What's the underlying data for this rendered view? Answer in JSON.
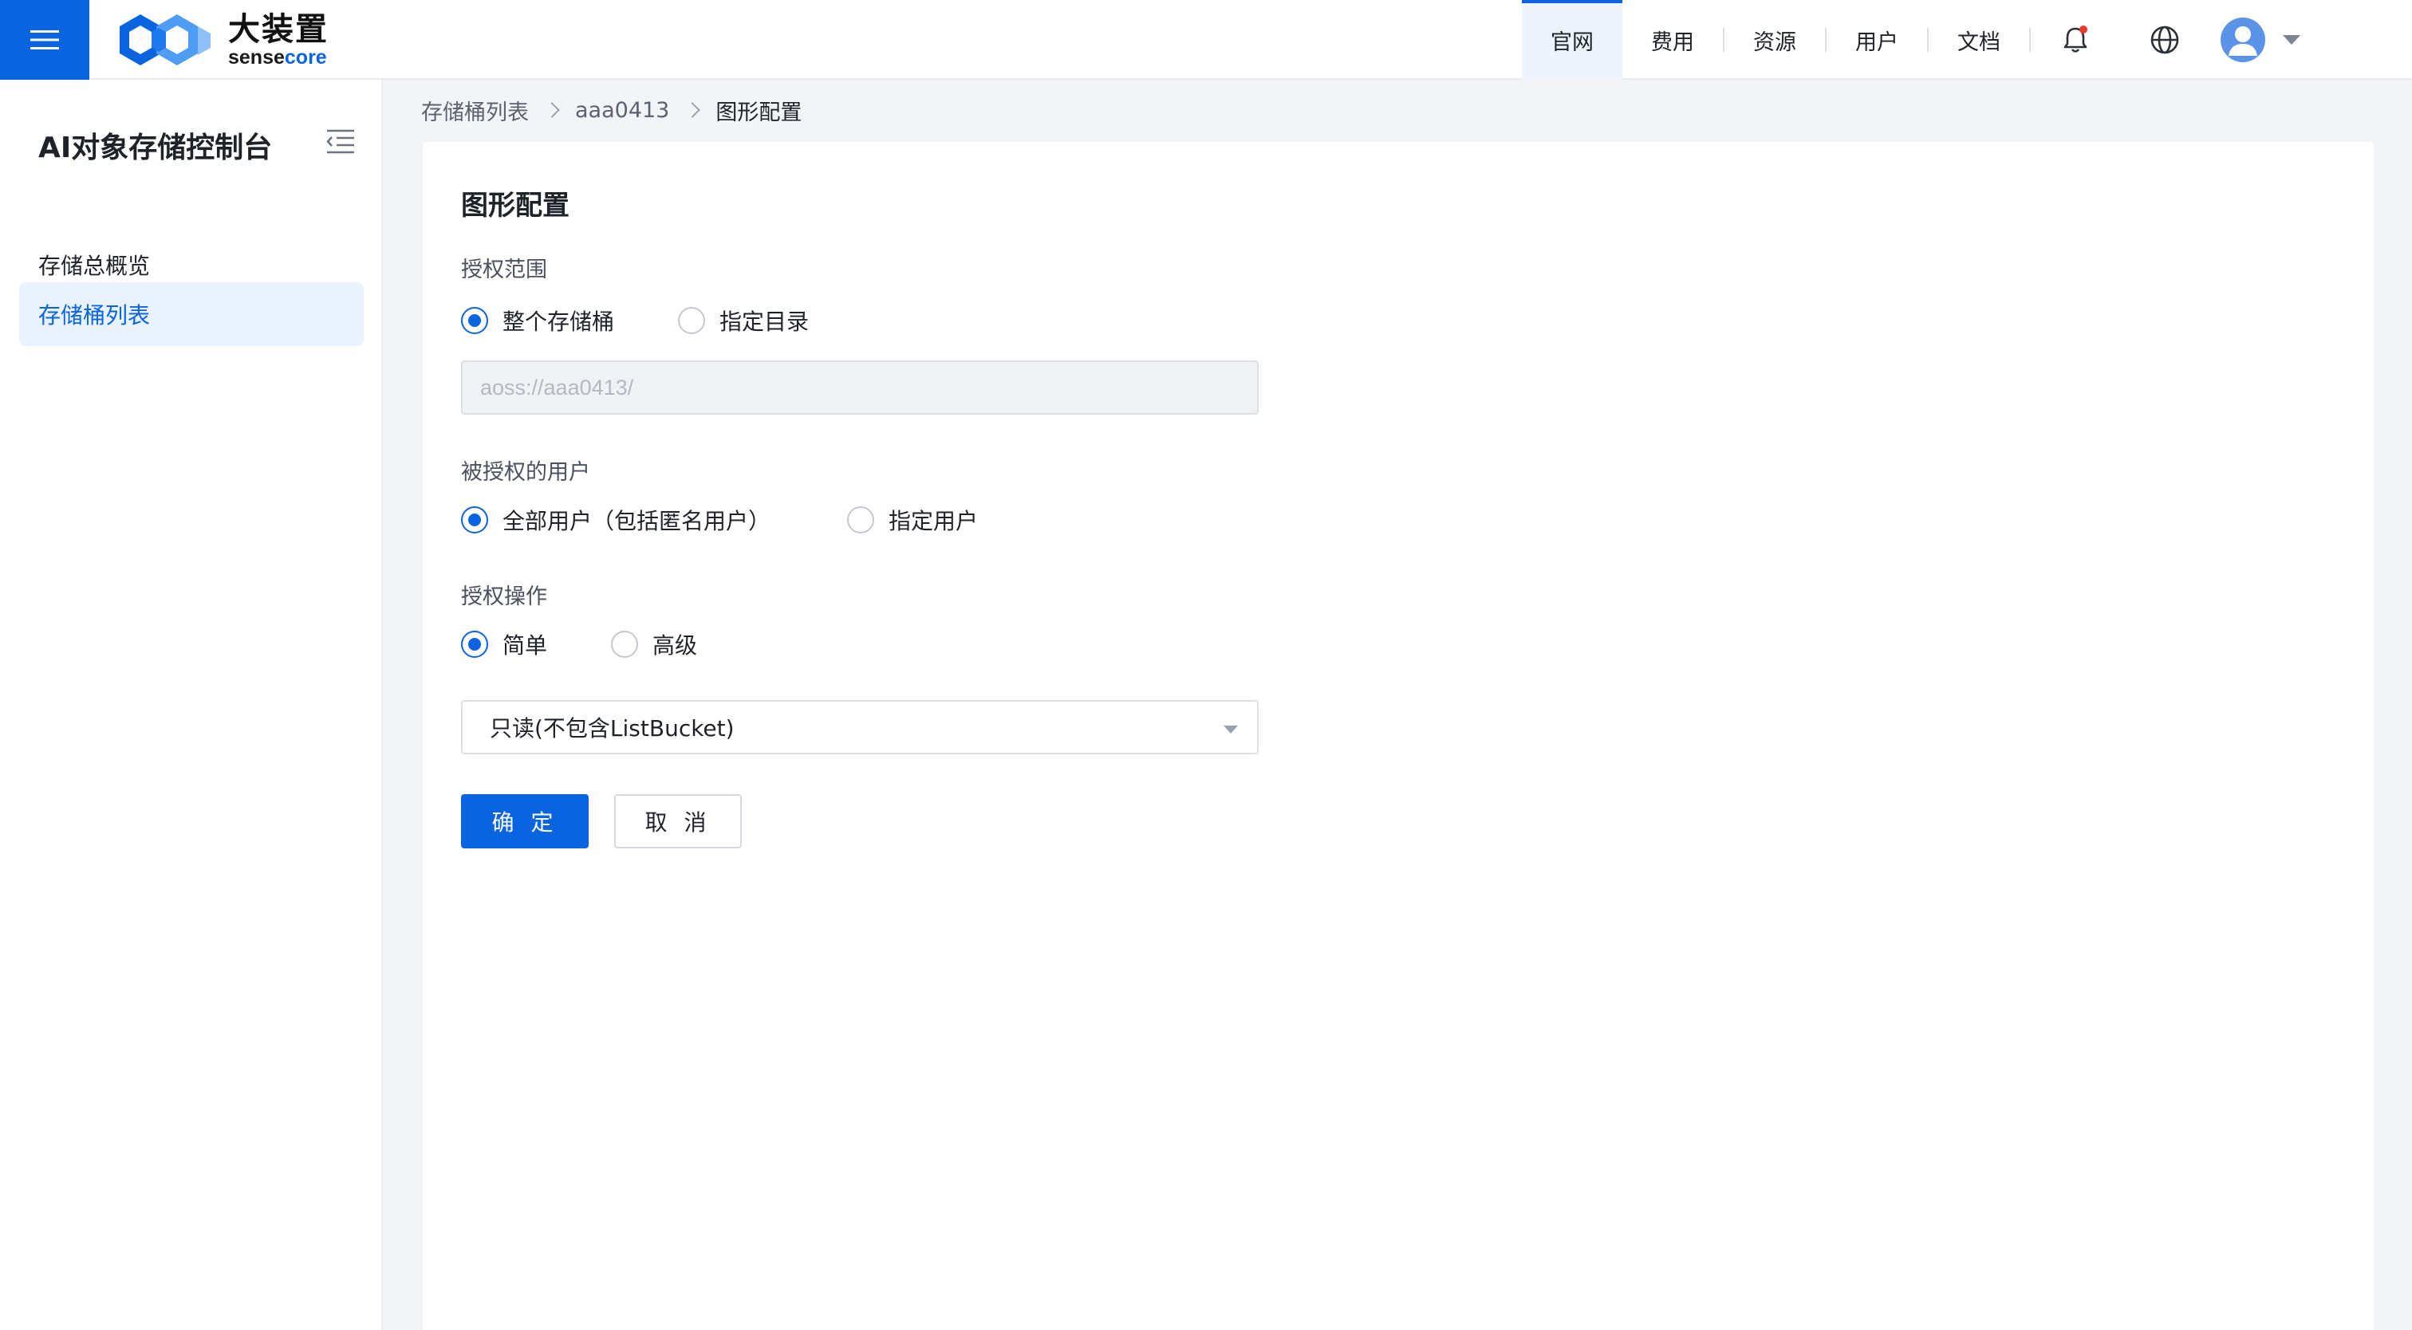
{
  "header": {
    "logo_cn": "大装置",
    "logo_en_prefix": "sense",
    "logo_en_suffix": "core",
    "nav": [
      "官网",
      "费用",
      "资源",
      "用户",
      "文档"
    ],
    "active_nav": "官网"
  },
  "sidebar": {
    "title": "AI对象存储控制台",
    "items": [
      {
        "label": "存储总概览"
      },
      {
        "label": "存储桶列表",
        "active": true
      }
    ]
  },
  "breadcrumb": [
    "存储桶列表",
    "aaa0413",
    "图形配置"
  ],
  "form": {
    "title": "图形配置",
    "scope": {
      "label": "授权范围",
      "options": [
        "整个存储桶",
        "指定目录"
      ],
      "selected": "整个存储桶",
      "path_value": "aoss://aaa0413/"
    },
    "users": {
      "label": "被授权的用户",
      "options": [
        "全部用户（包括匿名用户）",
        "指定用户"
      ],
      "selected": "全部用户（包括匿名用户）"
    },
    "operation": {
      "label": "授权操作",
      "options": [
        "简单",
        "高级"
      ],
      "selected": "简单",
      "permission_value": "只读(不包含ListBucket)"
    },
    "confirm_label": "确 定",
    "cancel_label": "取 消"
  },
  "colors": {
    "primary": "#0a64e0",
    "notification_dot": "#f0352b",
    "sidebar_active_bg": "#e9f2ff"
  }
}
